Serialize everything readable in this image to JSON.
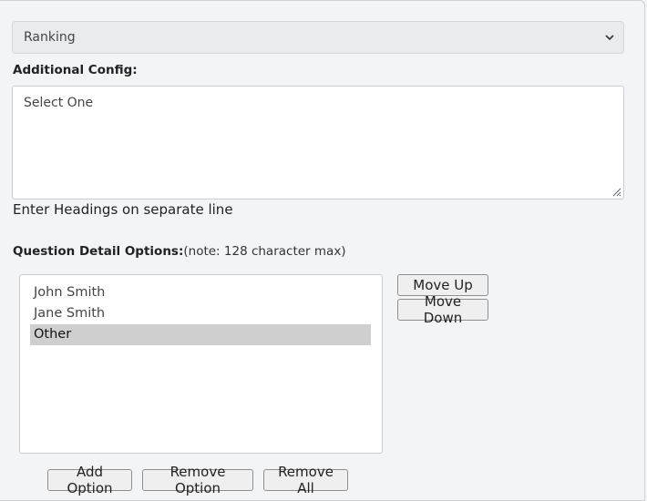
{
  "question_type_select": {
    "selected": "Ranking"
  },
  "additional_config": {
    "label": "Additional Config:",
    "value": "Select One",
    "helper_text": "Enter Headings on separate line"
  },
  "question_detail_options": {
    "label": "Question Detail Options:",
    "note": "(note: 128 character max)",
    "options": [
      "John Smith",
      "Jane Smith",
      "Other"
    ],
    "selected_option": "Other"
  },
  "buttons": {
    "move_up": "Move Up",
    "move_down": "Move Down",
    "add_option": "Add Option",
    "remove_option": "Remove Option",
    "remove_all": "Remove All"
  },
  "icons": {
    "select_caret": "chevron-down-icon",
    "resize_handle": "resize-grip-icon"
  }
}
